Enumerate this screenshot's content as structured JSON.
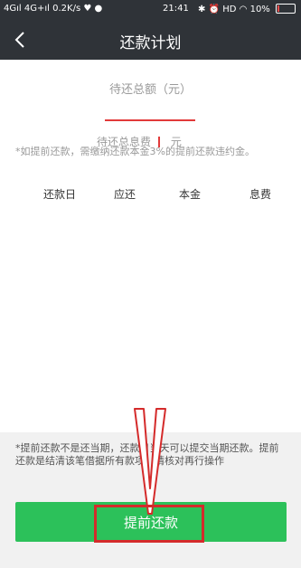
{
  "status_bar": {
    "network_left": "4G",
    "network_right": "4G+",
    "speed": "0.2K/s",
    "time": "21:41",
    "hd_label": "HD",
    "battery": "10%",
    "battery_level": 0.1,
    "battery_color": "#e84b4b"
  },
  "nav": {
    "title": "还款计划",
    "back_icon": "chevron-left-icon"
  },
  "summary": {
    "total_label": "待还总额（元）",
    "interest_label": "待还总息费",
    "interest_unit": "元",
    "notice": "*如提前还款，需缴纳还款本金3%的提前还款违约金。"
  },
  "table": {
    "columns": [
      "还款日",
      "应还",
      "本金",
      "息费"
    ]
  },
  "footer": {
    "note": "*提前还款不是还当期，还款日当天可以提交当期还款。提前还款是结清该笔借据所有款项，请核对再行操作",
    "prepay_button": "提前还款"
  },
  "colors": {
    "header_bg": "#2f3338",
    "button_green": "#2cc15a",
    "annotation_red": "#d42b2b"
  }
}
